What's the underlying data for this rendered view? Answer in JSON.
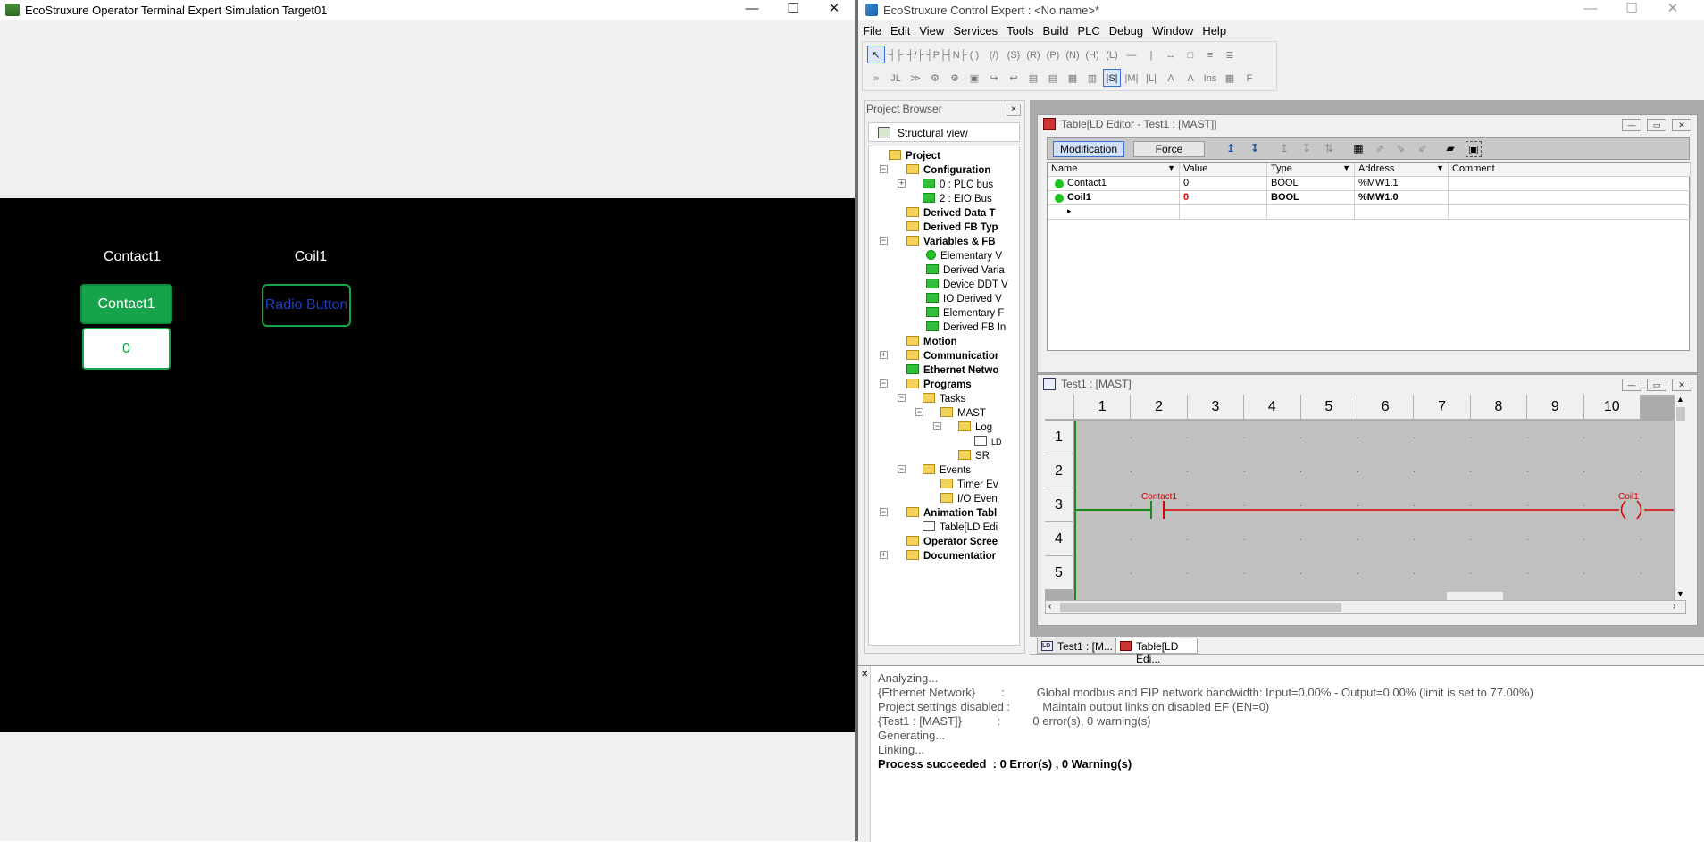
{
  "sim_window": {
    "title": "EcoStruxure Operator Terminal Expert Simulation  Target01",
    "controls": [
      "—",
      "☐",
      "✕"
    ],
    "contact1_label": "Contact1",
    "contact1_button": "Contact1",
    "contact1_value": "0",
    "coil1_label": "Coil1",
    "coil1_button": "Radio Button"
  },
  "ce_window": {
    "title": "EcoStruxure Control Expert : <No name>*",
    "controls": [
      "—",
      "☐",
      "✕"
    ],
    "menu": [
      "File",
      "Edit",
      "View",
      "Services",
      "Tools",
      "Build",
      "PLC",
      "Debug",
      "Window",
      "Help"
    ]
  },
  "project_browser": {
    "title": "Project Browser",
    "close": "×",
    "view": "Structural view",
    "tree": [
      "Project",
      "Configuration",
      "0 : PLC bus",
      "2 : EIO Bus",
      "Derived Data T",
      "Derived FB Typ",
      "Variables & FB",
      "Elementary V",
      "Derived Varia",
      "Device DDT V",
      "IO Derived V",
      "Elementary F",
      "Derived FB In",
      "Motion",
      "Communicatior",
      "Ethernet Netwo",
      "Programs",
      "Tasks",
      "MAST",
      "Log",
      "LD",
      "SR",
      "Events",
      "Timer Ev",
      "I/O Even",
      "Animation Tabl",
      "Table[LD Edi",
      "Operator Scree",
      "Documentatior"
    ]
  },
  "anim_table": {
    "title": "Table[LD Editor - Test1 : [MAST]]",
    "mode_modification": "Modification",
    "mode_force": "Force",
    "columns": [
      "Name",
      "Value",
      "Type",
      "Address",
      "Comment"
    ],
    "rows": [
      {
        "name": "Contact1",
        "value": "0",
        "type": "BOOL",
        "address": "%MW1.1",
        "comment": ""
      },
      {
        "name": "Coil1",
        "value": "0",
        "type": "BOOL",
        "address": "%MW1.0",
        "comment": ""
      }
    ],
    "new_row_marker": "▸"
  },
  "ld_editor": {
    "title": "Test1 : [MAST]",
    "columns": [
      "1",
      "2",
      "3",
      "4",
      "5",
      "6",
      "7",
      "8",
      "9",
      "10"
    ],
    "rows": [
      "1",
      "2",
      "3",
      "4",
      "5"
    ],
    "contact_label": "Contact1",
    "coil_label": "Coil1",
    "colors": {
      "rail": "#1a8a1a",
      "energized": "#e00000",
      "off": "#1a8a1a"
    }
  },
  "doc_tabs": [
    "Test1 : [M...",
    "Table[LD Edi..."
  ],
  "output": [
    {
      "text": "Analyzing...",
      "bold": false
    },
    {
      "text": "{Ethernet Network}        :          Global modbus and EIP network bandwidth: Input=0.00% - Output=0.00% (limit is set to 77.00%)",
      "bold": false
    },
    {
      "text": "Project settings disabled :          Maintain output links on disabled EF (EN=0)",
      "bold": false
    },
    {
      "text": "{Test1 : [MAST]}           :          0 error(s), 0 warning(s)",
      "bold": false
    },
    {
      "text": "Generating...",
      "bold": false
    },
    {
      "text": "Linking...",
      "bold": false
    },
    {
      "text": "Process succeeded  : 0 Error(s) , 0 Warning(s)",
      "bold": true
    }
  ]
}
